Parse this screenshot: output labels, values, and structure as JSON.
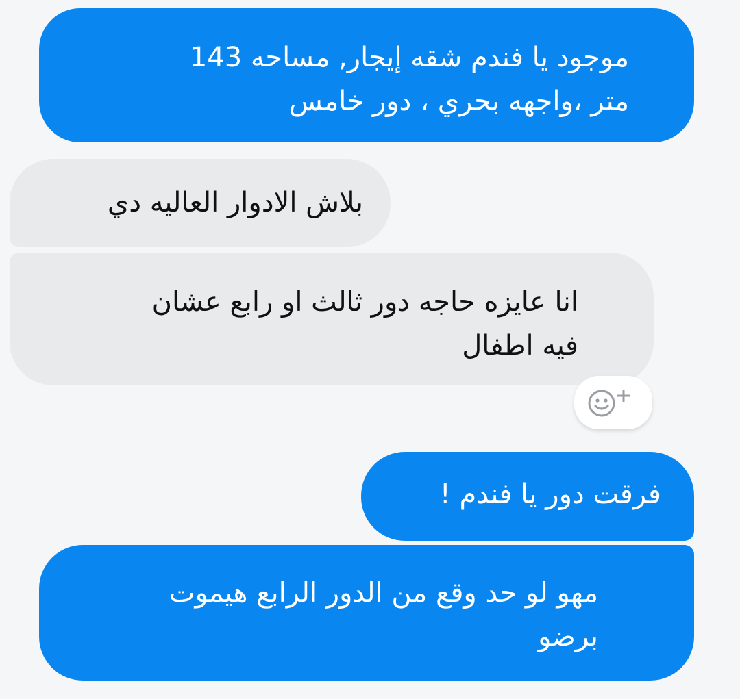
{
  "messages": [
    {
      "side": "sent",
      "text": "موجود يا فندم شقه إيجار, مساحه 143\nمتر ،واجهه بحري ، دور خامس"
    },
    {
      "side": "received",
      "text": "بلاش الادوار العاليه دي"
    },
    {
      "side": "received",
      "text": "انا عايزه حاجه دور ثالث او رابع عشان\nفيه اطفال"
    },
    {
      "side": "sent",
      "text": "فرقت دور يا فندم !"
    },
    {
      "side": "sent",
      "text": "مهو لو حد وقع من الدور الرابع هيموت\nبرضو"
    }
  ],
  "reaction_button": {
    "icon": "add-reaction-icon"
  },
  "colors": {
    "sent_bubble": "#0a86f0",
    "received_bubble": "#e9eaec",
    "background": "#f5f6f8"
  }
}
